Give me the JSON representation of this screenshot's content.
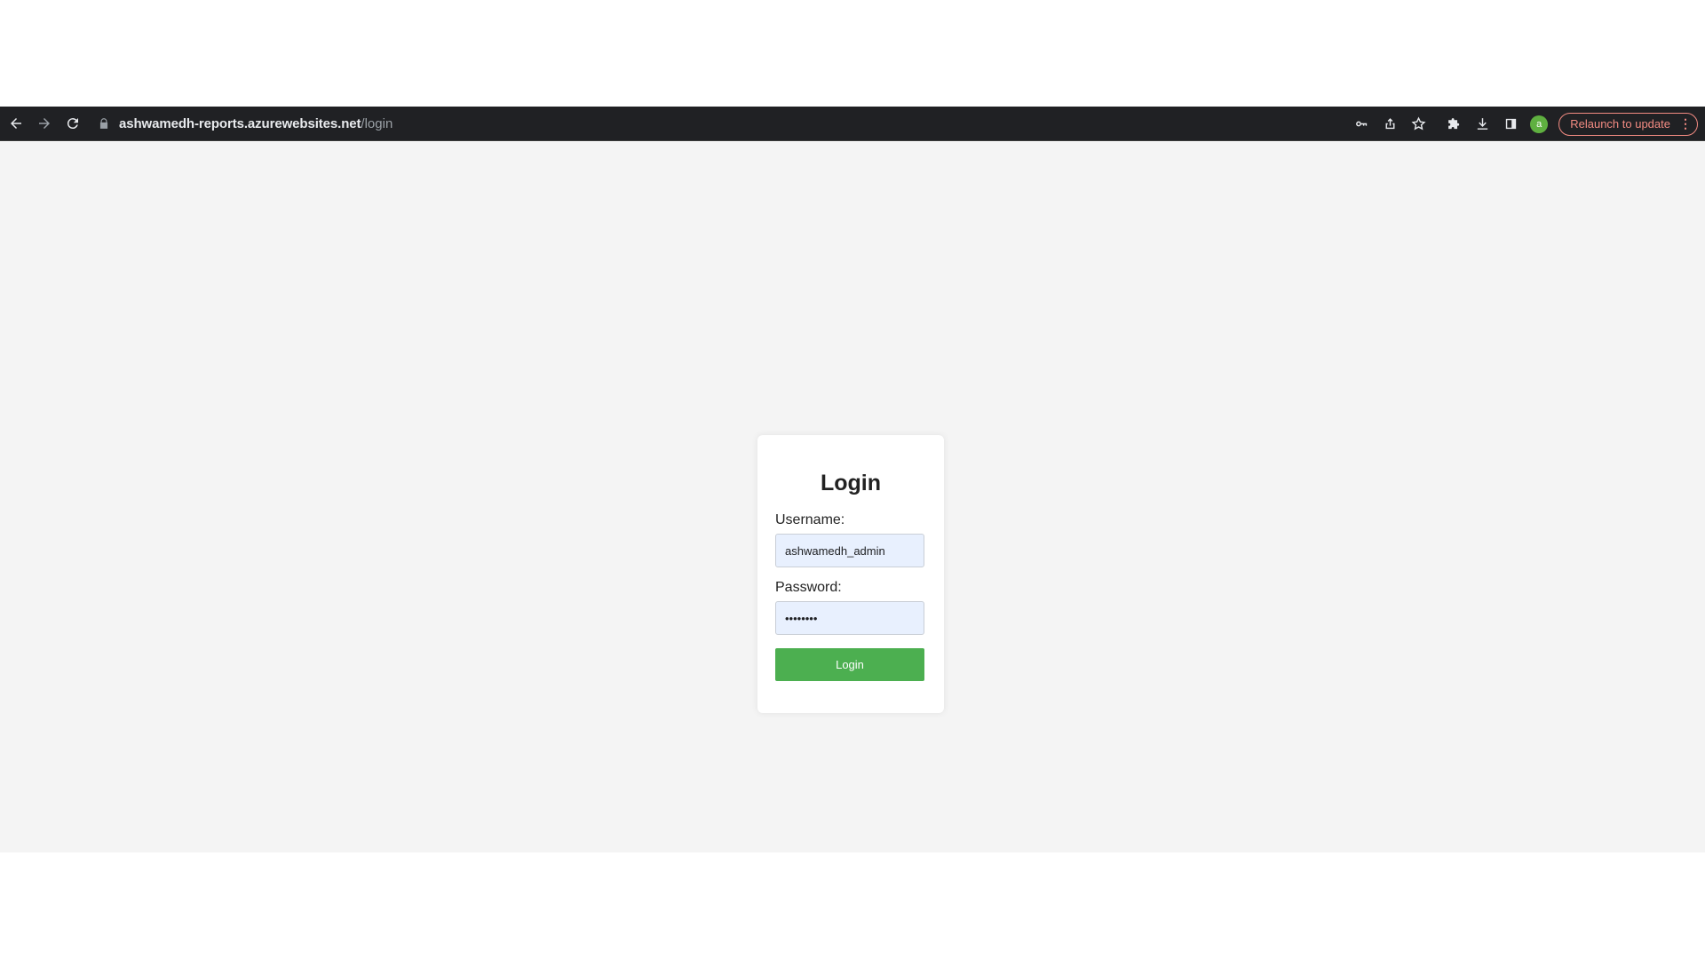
{
  "browser": {
    "url_host": "ashwamedh-reports.azurewebsites.net",
    "url_path": "/login",
    "avatar_letter": "a",
    "relaunch_label": "Relaunch to update",
    "relaunch_menu": "⋮",
    "icons": [
      "back-arrow-icon",
      "forward-arrow-icon",
      "reload-icon",
      "lock-icon",
      "key-icon",
      "share-icon",
      "star-icon",
      "extensions-icon",
      "download-icon",
      "side-panel-icon"
    ]
  },
  "login": {
    "title": "Login",
    "username_label": "Username:",
    "username_value": "ashwamedh_admin",
    "password_label": "Password:",
    "password_value": "••••••••",
    "button_label": "Login"
  },
  "colors": {
    "toolbar_bg": "#202124",
    "page_bg": "#f4f4f4",
    "button_green": "#4caf50",
    "input_bg": "#e8f0fe",
    "relaunch_accent": "#f28b82"
  }
}
